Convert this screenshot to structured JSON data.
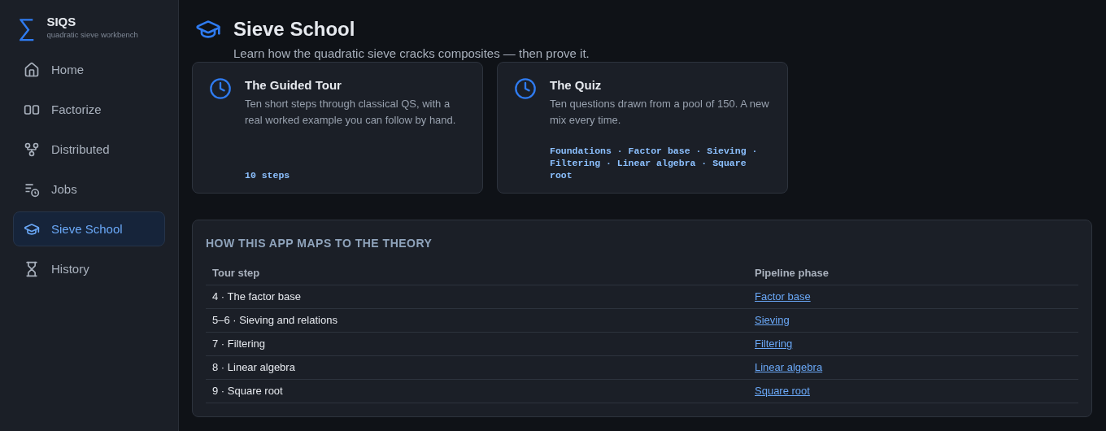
{
  "brand": {
    "title": "SIQS",
    "subtitle": "quadratic sieve workbench",
    "symbol": "∑"
  },
  "sidebar": {
    "items": [
      {
        "label": "Home",
        "selected": false
      },
      {
        "label": "Factorize",
        "selected": false
      },
      {
        "label": "Distributed",
        "selected": false
      },
      {
        "label": "Jobs",
        "selected": false
      },
      {
        "label": "Sieve School",
        "selected": true
      },
      {
        "label": "History",
        "selected": false
      }
    ]
  },
  "header": {
    "title": "Sieve School",
    "subtitle": "Learn how the quadratic sieve cracks composites — then prove it."
  },
  "cards": [
    {
      "title": "The Guided Tour",
      "description": "Ten short steps through classical QS, with a real worked example you can follow by hand.",
      "footer": "10 steps"
    },
    {
      "title": "The Quiz",
      "description": "Ten questions drawn from a pool of 150. A new mix every time.",
      "footer": "Foundations · Factor base · Sieving · Filtering · Linear algebra · Square root"
    }
  ],
  "theory": {
    "title": "HOW THIS APP MAPS TO THE THEORY",
    "columns": [
      "Tour step",
      "Pipeline phase"
    ],
    "rows": [
      {
        "step": "4 · The factor base",
        "phase": "Factor base"
      },
      {
        "step": "5–6 · Sieving and relations",
        "phase": "Sieving"
      },
      {
        "step": "7 · Filtering",
        "phase": "Filtering"
      },
      {
        "step": "8 · Linear algebra",
        "phase": "Linear algebra"
      },
      {
        "step": "9 · Square root",
        "phase": "Square root"
      }
    ]
  }
}
